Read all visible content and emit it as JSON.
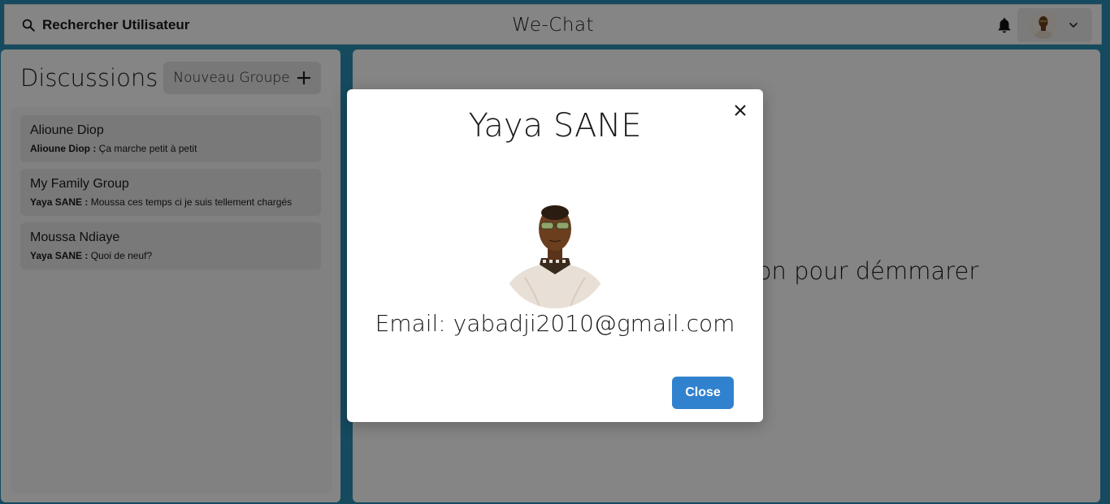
{
  "header": {
    "search_label": "Rechercher Utilisateur",
    "app_title": "We-Chat"
  },
  "sidebar": {
    "title": "Discussions",
    "new_group_label": "Nouveau Groupe",
    "chats": [
      {
        "name": "Alioune Diop",
        "sender": "Alioune Diop :",
        "message": "Ça marche petit à petit"
      },
      {
        "name": "My Family Group",
        "sender": "Yaya SANE :",
        "message": "Moussa ces temps ci je suis tellement chargés"
      },
      {
        "name": "Moussa Ndiaye",
        "sender": "Yaya SANE :",
        "message": "Quoi de neuf?"
      }
    ]
  },
  "main": {
    "empty_message": "Cliquez sur une discussion pour démmarer"
  },
  "modal": {
    "title": "Yaya SANE",
    "email": "Email: yabadji2010@gmail.com",
    "close_label": "Close"
  },
  "colors": {
    "accent": "#3182ce",
    "background": "#2a8fb6"
  },
  "icons": {
    "search": "search-icon",
    "bell": "bell-icon",
    "chevron": "chevron-down-icon",
    "plus": "plus-icon",
    "close": "close-icon"
  }
}
